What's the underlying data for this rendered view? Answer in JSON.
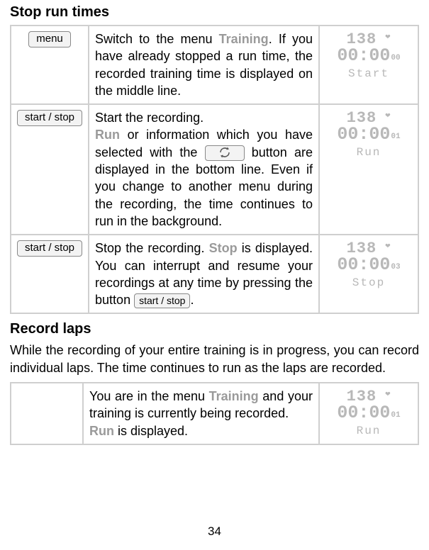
{
  "section1": {
    "heading": "Stop run times",
    "rows": [
      {
        "button": "menu",
        "desc_parts": {
          "t1": "Switch to the menu ",
          "gray": "Training",
          "t2": ". If you have already stopped a run time, the recorded training time is displayed on the middle line."
        },
        "screen": {
          "r1": "138",
          "r2": "00:00",
          "r2sub": "00",
          "r3": "Start"
        }
      },
      {
        "button": "start / stop",
        "desc_parts": {
          "p1": "Start the recording.",
          "gray": "Run",
          "t2": " or information which you have selected with the ",
          "t3": " button are displayed in the bottom line. Even if you change to another menu during the recording, the time continues to run in the background."
        },
        "screen": {
          "r1": "138",
          "r2": "00:00",
          "r2sub": "01",
          "r3": "Run"
        }
      },
      {
        "button": "start / stop",
        "desc_parts": {
          "t1": "Stop the recording. ",
          "gray": "Stop",
          "t2": " is displayed. You can interrupt and resume your recordings at any time by pressing the button ",
          "inlinebtn": "start / stop",
          "t3": "."
        },
        "screen": {
          "r1": "138",
          "r2": "00:00",
          "r2sub": "03",
          "r3": "Stop"
        }
      }
    ]
  },
  "section2": {
    "heading": "Record laps",
    "intro": "While the recording of your entire training is in progress, you can record individual laps. The time continues to run as the laps are recorded.",
    "rows": [
      {
        "button": "",
        "desc_parts": {
          "t1": "You are in the menu ",
          "gray": "Training",
          "t2": " and your training is currently being recorded.",
          "line2gray": "Run",
          "line2rest": " is displayed."
        },
        "screen": {
          "r1": "138",
          "r2": "00:00",
          "r2sub": "01",
          "r3": "Run"
        }
      }
    ]
  },
  "page": "34"
}
